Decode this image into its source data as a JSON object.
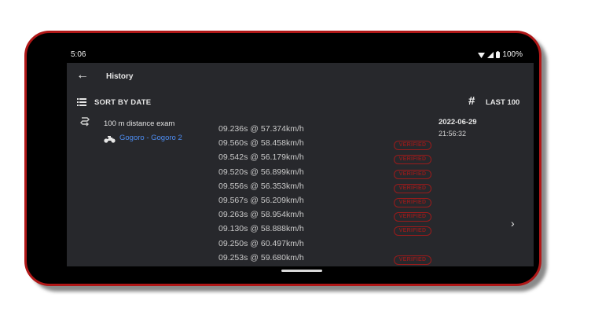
{
  "status_bar": {
    "time": "5:06",
    "battery": "100%"
  },
  "app_bar": {
    "title": "History"
  },
  "sort_bar": {
    "sort_label": "SORT BY DATE",
    "last_label": "LAST 100"
  },
  "entry": {
    "exam_name": "100 m distance exam",
    "vehicle": "Gogoro - Gogoro 2",
    "date": "2022-06-29",
    "time": "21:56:32",
    "verified_label": "VERIFIED",
    "results": [
      {
        "text": "09.236s @ 57.374km/h",
        "verified": false
      },
      {
        "text": "09.560s @ 58.458km/h",
        "verified": true
      },
      {
        "text": "09.542s @ 56.179km/h",
        "verified": true
      },
      {
        "text": "09.520s @ 56.899km/h",
        "verified": true
      },
      {
        "text": "09.556s @ 56.353km/h",
        "verified": true
      },
      {
        "text": "09.567s @ 56.209km/h",
        "verified": true
      },
      {
        "text": "09.263s @ 58.954km/h",
        "verified": true
      },
      {
        "text": "09.130s @ 58.888km/h",
        "verified": true
      },
      {
        "text": "09.250s @ 60.497km/h",
        "verified": false
      },
      {
        "text": "09.253s @ 59.680km/h",
        "verified": true
      }
    ]
  },
  "colors": {
    "frame": "#b01818",
    "screen_bg": "#27282c",
    "link": "#4d8cf0",
    "verified": "#8d1c1c"
  },
  "icons": [
    "back-arrow",
    "sort-lines",
    "hash",
    "route",
    "motorcycle",
    "chevron-right",
    "sim",
    "wifi",
    "signal",
    "battery"
  ]
}
